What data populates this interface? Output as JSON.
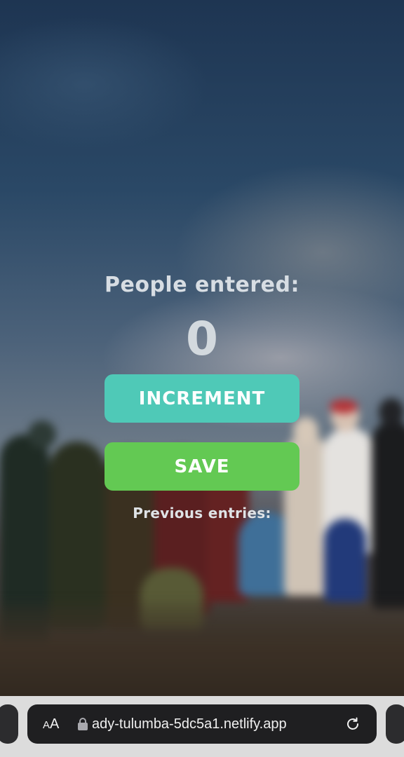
{
  "counter": {
    "title": "People entered:",
    "count": "0",
    "increment_label": "INCREMENT",
    "save_label": "SAVE",
    "previous_label": "Previous entries:"
  },
  "browser": {
    "text_size_small": "A",
    "text_size_big": "A",
    "url": "ady-tulumba-5dc5a1.netlify.app"
  },
  "colors": {
    "increment_button": "#4fc9b7",
    "save_button": "#63c953",
    "text_light": "#d7dde3"
  },
  "icons": [
    "lock-icon",
    "reload-icon",
    "text-size-icon"
  ]
}
